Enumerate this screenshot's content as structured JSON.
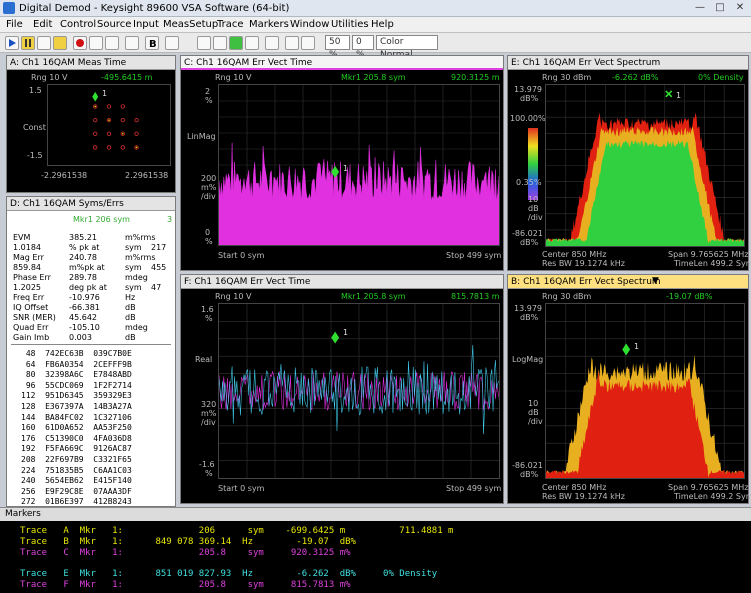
{
  "window": {
    "title": "Digital Demod - Keysight 89600 VSA Software (64-bit)"
  },
  "menu": [
    "File",
    "Edit",
    "Control",
    "Source",
    "Input",
    "MeasSetup",
    "Trace",
    "Markers",
    "Window",
    "Utilities",
    "Help"
  ],
  "toolbar": {
    "zoom": "50 %",
    "zoom2": "0 %",
    "color": "Color Normal"
  },
  "panelA": {
    "title": "A: Ch1 16QAM Meas Time",
    "rng": "Rng 10  V",
    "mkr": "-495.6415 m",
    "y_top": "1.5",
    "y_mid": "Const",
    "y_bot": "-1.5",
    "x_left": "-2.2961538",
    "x_right": "2.2961538",
    "marker_num": "1"
  },
  "panelC": {
    "title": "C: Ch1 16QAM Err Vect Time",
    "rng": "Rng 10  V",
    "mkr": "Mkr1  205.8  sym",
    "mkr_val": "920.3125 m",
    "y_top": "2",
    "y_top_unit": "%",
    "y_mid": "LinMag",
    "y_scale": "200",
    "y_scale_unit": "m%",
    "y_scale_unit2": "/div",
    "y_bot": "0",
    "y_bot_unit": "%",
    "start": "Start 0  sym",
    "stop": "Stop 499  sym",
    "marker_num": "1"
  },
  "panelD": {
    "title": "D: Ch1 16QAM Syms/Errs",
    "mkr": "Mkr1  206  sym",
    "mkr_idx": "3",
    "rows": [
      {
        "name": "EVM",
        "val": "385.21",
        "unit": "m%rms"
      },
      {
        "name": "1.0184",
        "val": "% pk  at",
        "unit": "sym",
        "extra": "217"
      },
      {
        "name": "Mag Err",
        "val": "240.78",
        "unit": "m%rms"
      },
      {
        "name": "859.84",
        "val": "m%pk  at",
        "unit": "sym",
        "extra": "455"
      },
      {
        "name": "Phase Err",
        "val": "289.78",
        "unit": "mdeg"
      },
      {
        "name": "1.2025",
        "val": "deg pk  at",
        "unit": "sym",
        "extra": "47"
      },
      {
        "name": "Freq Err",
        "val": "-10.976",
        "unit": "Hz"
      },
      {
        "name": "IQ Offset",
        "val": "-66.381",
        "unit": "dB"
      },
      {
        "name": "SNR (MER)",
        "val": "45.642",
        "unit": "dB"
      },
      {
        "name": "Quad Err",
        "val": "-105.10",
        "unit": "mdeg"
      },
      {
        "name": "Gain Imb",
        "val": "0.003",
        "unit": "dB"
      }
    ],
    "hex": [
      " 48  742EC63B  039C7B0E",
      " 64  FB6A0354  2CEFFF9B",
      " 80  32398A6C  E7848ABD",
      " 96  55CDC069  1F2F2714",
      "112  951D6345  359329E3",
      "128  E367397A  14B3A27A",
      "144  BA84FC02  1C327106",
      "160  61D0A652  AA53F250",
      "176  C51390C0  4FA036D8",
      "192  F5FA669C  9126AC87",
      "208  22F697B9  C3321F65",
      "224  751835B5  C6AA1C03",
      "240  5654EB62  E415F140",
      "256  E9F29C8E  07AAA3DF",
      "272  01B6E397  412B8243"
    ]
  },
  "panelE": {
    "title": "E: Ch1 16QAM Err Vect Spectrum",
    "rng": "Rng 30  dBm",
    "mkr": "-6.262  dB%",
    "mkr2": "0% Density",
    "y_top": "13.979",
    "y_top_unit": "dB%",
    "y_pct1": "100.00%",
    "y_pct2": "0.35%",
    "y_scale": "10",
    "y_scale_unit": "dB",
    "y_scale_unit2": "/div",
    "y_bot": "-86.021",
    "y_bot_unit": "dB%",
    "center": "Center 850 MHz",
    "span": "Span 9.765625 MHz",
    "resbw": "Res BW 19.1274 kHz",
    "timelen": "TimeLen 499.2  Sym",
    "marker_num": "1"
  },
  "panelF": {
    "title": "F: Ch1 16QAM Err Vect Time",
    "rng": "Rng 10  V",
    "mkr": "Mkr1  205.8  sym",
    "mkr_val": "815.7813 m",
    "y_top": "1.6",
    "y_top_unit": "%",
    "y_mid": "Real",
    "y_scale": "320",
    "y_scale_unit": "m%",
    "y_scale_unit2": "/div",
    "y_bot": "-1.6",
    "y_bot_unit": "%",
    "start": "Start 0  sym",
    "stop": "Stop 499  sym",
    "marker_num": "1"
  },
  "panelB": {
    "title": "B: Ch1 16QAM Err Vect Spectrum",
    "rng": "Rng 30  dBm",
    "mkr": "-19.07  dB%",
    "y_top": "13.979",
    "y_top_unit": "dB%",
    "y_mid": "LogMag",
    "y_scale": "10",
    "y_scale_unit": "dB",
    "y_scale_unit2": "/div",
    "y_bot": "-86.021",
    "y_bot_unit": "dB%",
    "center": "Center 850 MHz",
    "span": "Span 9.765625 MHz",
    "resbw": "Res BW 19.1274 kHz",
    "timelen": "TimeLen 499.2  Sym",
    "marker_num": "1"
  },
  "markers": {
    "title": "Markers",
    "rows": [
      {
        "text": "Trace   A  Mkr   1:              206      sym    -699.6425 m          711.4881 m",
        "color": "#e8e800"
      },
      {
        "text": "Trace   B  Mkr   1:      849 078 369.14  Hz        -19.07  dB%",
        "color": "#e8e800"
      },
      {
        "text": "Trace   C  Mkr   1:              205.8    sym     920.3125 m%",
        "color": "#e040e0"
      },
      {
        "text": "Trace   E  Mkr   1:      851 019 827.93  Hz        -6.262  dB%     0% Density",
        "color": "#40e0e0"
      },
      {
        "text": "Trace   F  Mkr   1:              205.8    sym     815.7813 m%",
        "color": "#e040e0"
      }
    ]
  }
}
